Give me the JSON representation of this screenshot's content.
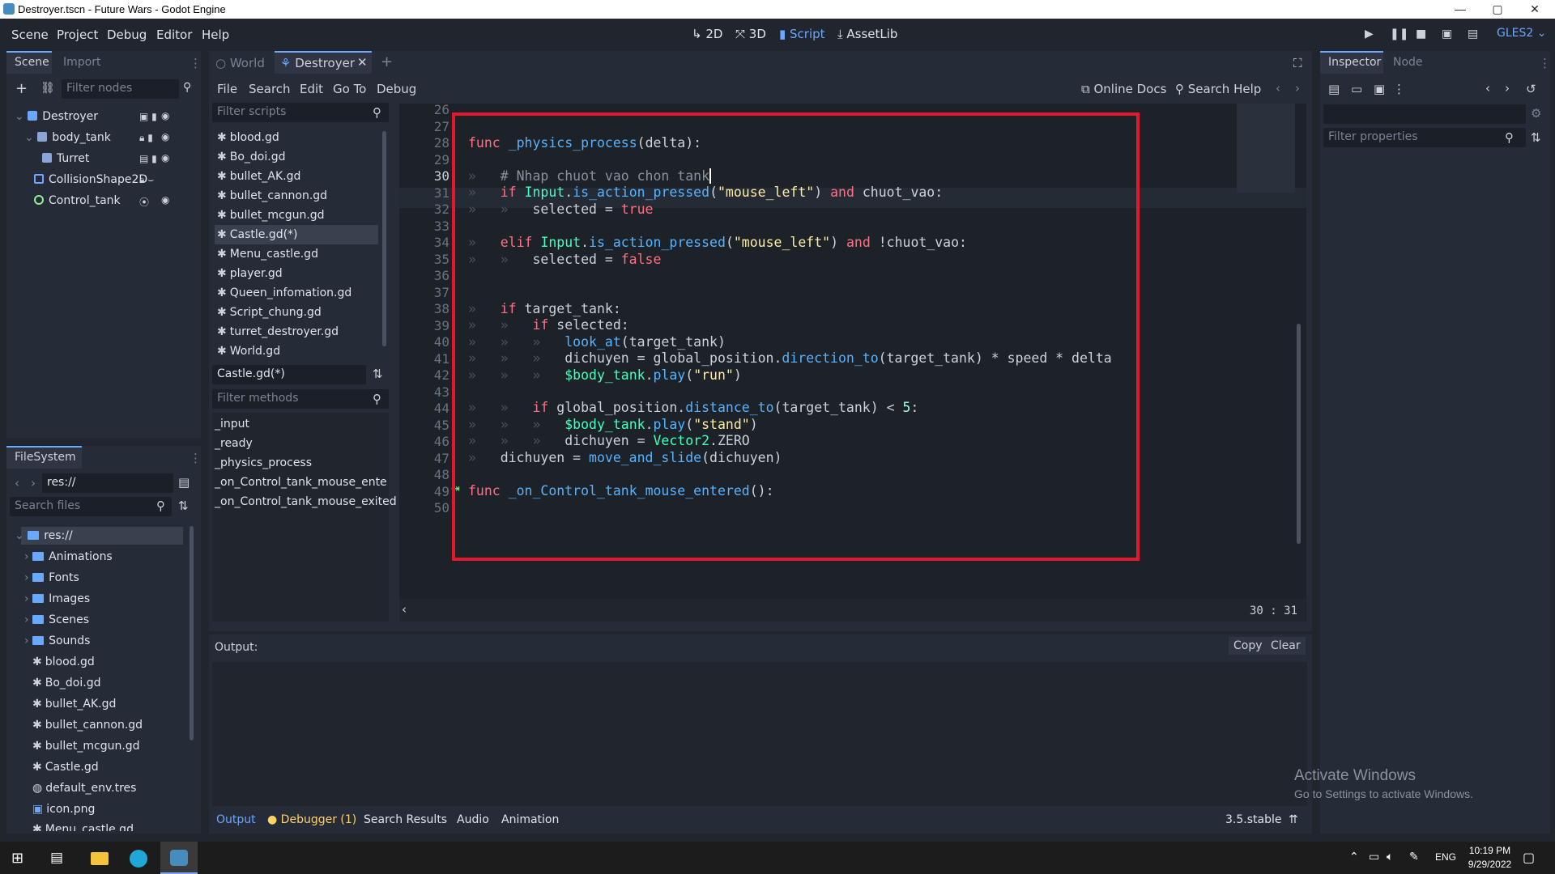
{
  "window": {
    "title": "Destroyer.tscn - Future Wars - Godot Engine",
    "controls": [
      "—",
      "▢",
      "✕"
    ]
  },
  "menu": [
    "Scene",
    "Project",
    "Debug",
    "Editor",
    "Help"
  ],
  "workspaces": [
    "2D",
    "3D",
    "Script",
    "AssetLib"
  ],
  "active_workspace": "Script",
  "renderer": "GLES2",
  "scene_dock": {
    "tabs": [
      "Scene",
      "Import"
    ],
    "filter_placeholder": "Filter nodes",
    "nodes": [
      "Destroyer",
      "body_tank",
      "Turret",
      "CollisionShape2D",
      "Control_tank"
    ]
  },
  "filesystem": {
    "tab": "FileSystem",
    "path": "res://",
    "search_placeholder": "Search files",
    "items": [
      {
        "name": "res://",
        "type": "root"
      },
      {
        "name": "Animations",
        "type": "folder"
      },
      {
        "name": "Fonts",
        "type": "folder"
      },
      {
        "name": "Images",
        "type": "folder"
      },
      {
        "name": "Scenes",
        "type": "folder"
      },
      {
        "name": "Sounds",
        "type": "folder"
      },
      {
        "name": "blood.gd",
        "type": "script"
      },
      {
        "name": "Bo_doi.gd",
        "type": "script"
      },
      {
        "name": "bullet_AK.gd",
        "type": "script"
      },
      {
        "name": "bullet_cannon.gd",
        "type": "script"
      },
      {
        "name": "bullet_mcgun.gd",
        "type": "script"
      },
      {
        "name": "Castle.gd",
        "type": "script"
      },
      {
        "name": "default_env.tres",
        "type": "resource"
      },
      {
        "name": "icon.png",
        "type": "image"
      },
      {
        "name": "Menu_castle.gd",
        "type": "script"
      }
    ]
  },
  "editor_tabs": [
    "World",
    "Destroyer"
  ],
  "script_menu": [
    "File",
    "Search",
    "Edit",
    "Go To",
    "Debug"
  ],
  "help_buttons": [
    "Online Docs",
    "Search Help"
  ],
  "scripts": {
    "filter_placeholder": "Filter scripts",
    "list": [
      "blood.gd",
      "Bo_doi.gd",
      "bullet_AK.gd",
      "bullet_cannon.gd",
      "bullet_mcgun.gd",
      "Castle.gd(*)",
      "Menu_castle.gd",
      "player.gd",
      "Queen_infomation.gd",
      "Script_chung.gd",
      "turret_destroyer.gd",
      "World.gd"
    ],
    "selected": "Castle.gd(*)",
    "current": "Castle.gd(*)",
    "methods_placeholder": "Filter methods",
    "methods": [
      "_input",
      "_ready",
      "_physics_process",
      "_on_Control_tank_mouse_entered",
      "_on_Control_tank_mouse_exited"
    ]
  },
  "code": {
    "line_numbers": [
      "26",
      "27",
      "28",
      "29",
      "30",
      "31",
      "32",
      "33",
      "34",
      "35",
      "36",
      "37",
      "38",
      "39",
      "40",
      "41",
      "42",
      "43",
      "44",
      "45",
      "46",
      "47",
      "48",
      "49",
      "50"
    ],
    "cursor": "30 :  31"
  },
  "inspector": {
    "tabs": [
      "Inspector",
      "Node"
    ],
    "filter_placeholder": "Filter properties"
  },
  "output": {
    "label": "Output:",
    "buttons": [
      "Copy",
      "Clear"
    ]
  },
  "bottom_tabs": [
    "Output",
    "Debugger (1)",
    "Search Results",
    "Audio",
    "Animation"
  ],
  "version": "3.5.stable",
  "watermark": {
    "title": "Activate Windows",
    "subtitle": "Go to Settings to activate Windows."
  },
  "taskbar": {
    "lang": "ENG",
    "time": "10:19 PM",
    "date": "9/29/2022"
  },
  "colors": {
    "accent": "#6aa7ff",
    "highlight_box": "#e3182d"
  }
}
